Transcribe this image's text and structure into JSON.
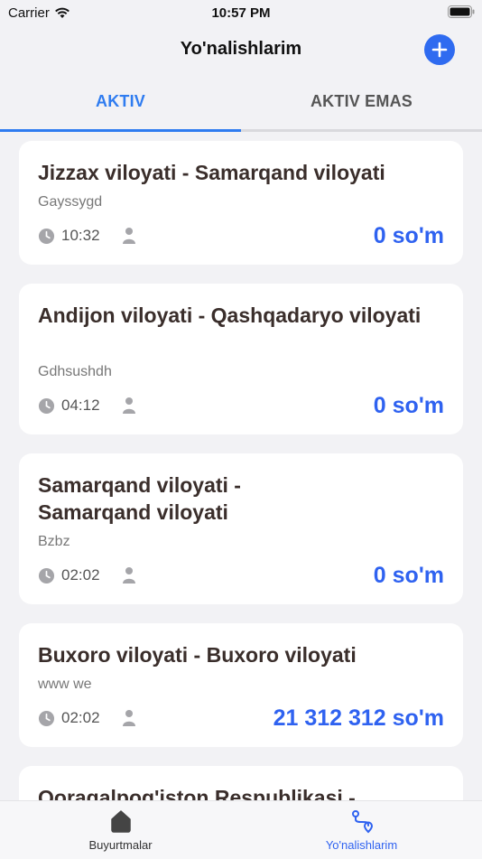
{
  "status_bar": {
    "carrier": "Carrier",
    "time": "10:57 PM"
  },
  "header": {
    "title": "Yo'nalishlarim"
  },
  "tabs": [
    {
      "label": "AKTIV",
      "active": true
    },
    {
      "label": "AKTIV EMAS",
      "active": false
    }
  ],
  "cards": [
    {
      "route": "Jizzax viloyati - Samarqand viloyati",
      "description": "Gayssygd",
      "time": "10:32",
      "price": "0 so'm"
    },
    {
      "route": "Andijon viloyati - Qashqadaryo viloyati",
      "description": "Gdhsushdh",
      "time": "04:12",
      "price": "0 so'm"
    },
    {
      "route": "Samarqand viloyati - Samarqand viloyati",
      "description": "Bzbz",
      "time": "02:02",
      "price": "0 so'm"
    },
    {
      "route": "Buxoro viloyati - Buxoro viloyati",
      "description": "www we",
      "time": "02:02",
      "price": "21 312 312 so'm"
    },
    {
      "route": "Qoraqalpog'iston Respublikasi -",
      "description": "",
      "time": "",
      "price": ""
    }
  ],
  "bottom_nav": [
    {
      "label": "Buyurtmalar",
      "icon": "home-icon",
      "active": false
    },
    {
      "label": "Yo'nalishlarim",
      "icon": "route-icon",
      "active": true
    }
  ],
  "colors": {
    "accent": "#2f7cf0",
    "price": "#2f62f0",
    "route_text": "#3a2e2b",
    "background": "#f2f2f5"
  }
}
